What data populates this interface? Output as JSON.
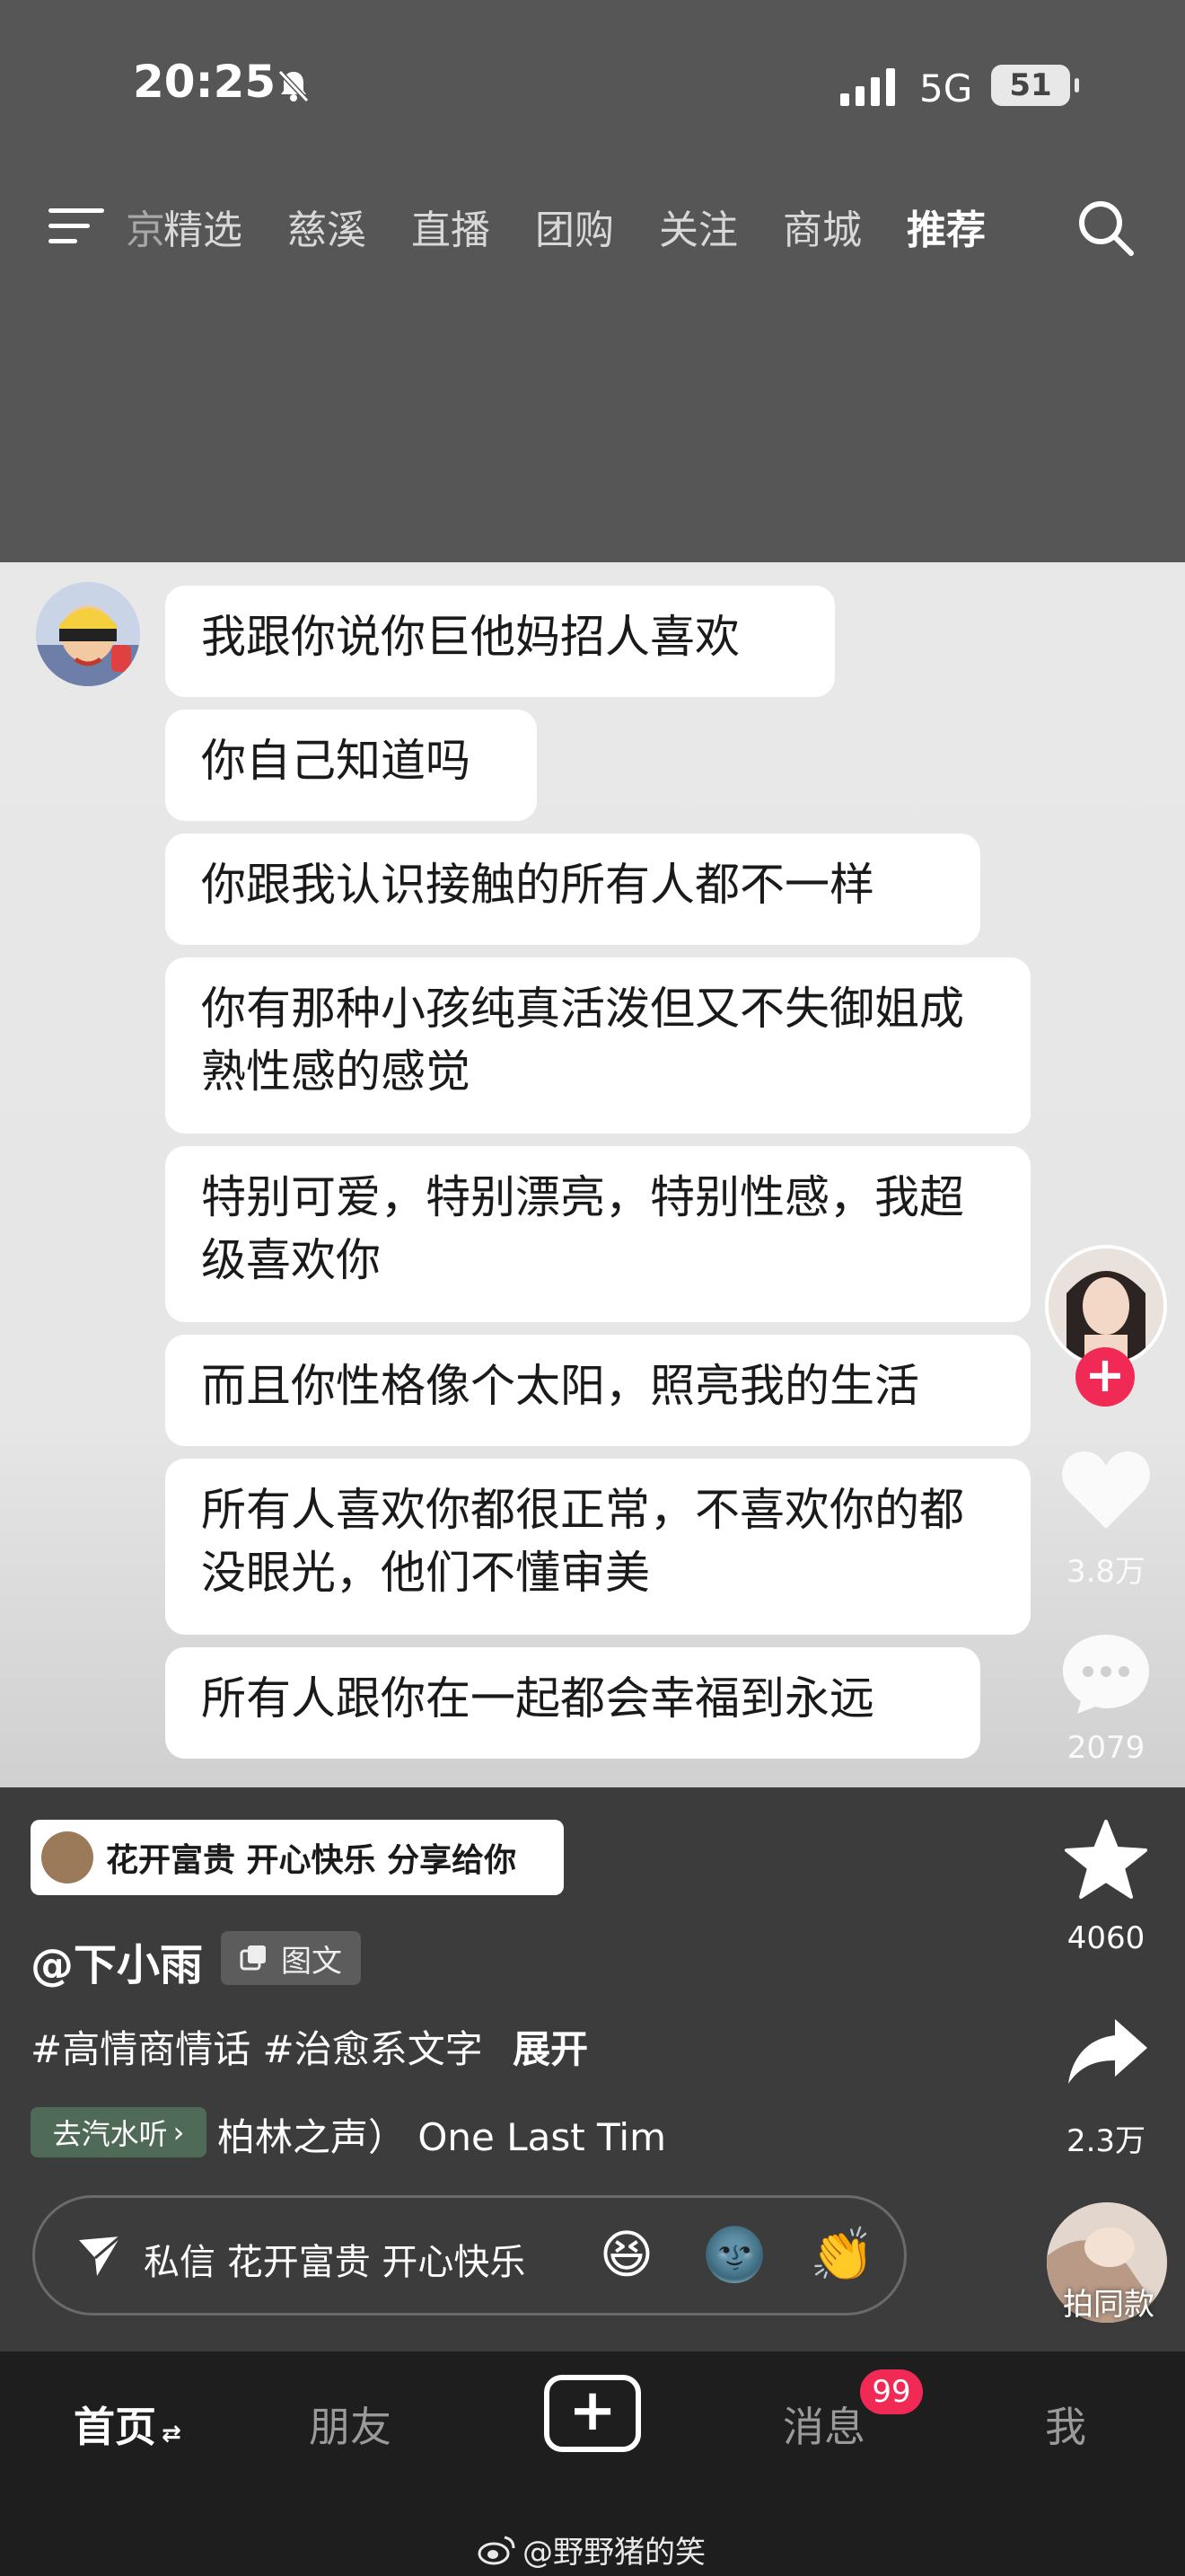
{
  "status_bar": {
    "time": "20:25",
    "network": "5G",
    "battery": "51"
  },
  "top_tabs": [
    {
      "label": "京",
      "partial": true
    },
    {
      "label": "精选"
    },
    {
      "label": "慈溪"
    },
    {
      "label": "直播"
    },
    {
      "label": "团购"
    },
    {
      "label": "关注"
    },
    {
      "label": "商城"
    },
    {
      "label": "推荐",
      "active": true
    }
  ],
  "messages": [
    "我跟你说你巨他妈招人喜欢",
    "你自己知道吗",
    "你跟我认识接触的所有人都不一样",
    "你有那种小孩纯真活泼但又不失御姐成熟性感的感觉",
    "特别可爱，特别漂亮，特别性感，我超级喜欢你",
    "而且你性格像个太阳，照亮我的生活",
    "所有人喜欢你都很正常，不喜欢你的都没眼光，他们不懂审美",
    "所有人跟你在一起都会幸福到永远"
  ],
  "side_actions": {
    "likes": "3.8万",
    "comments": "2079",
    "favorites": "4060",
    "shares": "2.3万",
    "same_style": "拍同款"
  },
  "post": {
    "share_chip": "花开富贵 开心快乐 分享给你",
    "author": "@下小雨",
    "type_badge": "图文",
    "hashtags": "#高情商情话 #治愈系文字",
    "expand": "展开",
    "music_chip": "去汽水听",
    "music_text": "柏林之声） One Last Tim"
  },
  "dm_bar": {
    "text": "私信 花开富贵 开心快乐",
    "emojis": [
      "😆",
      "🌚",
      "👏"
    ]
  },
  "bottom_nav": {
    "home": "首页",
    "friends": "朋友",
    "messages": "消息",
    "messages_badge": "99",
    "me": "我"
  },
  "watermark": "@野野猪的笑"
}
